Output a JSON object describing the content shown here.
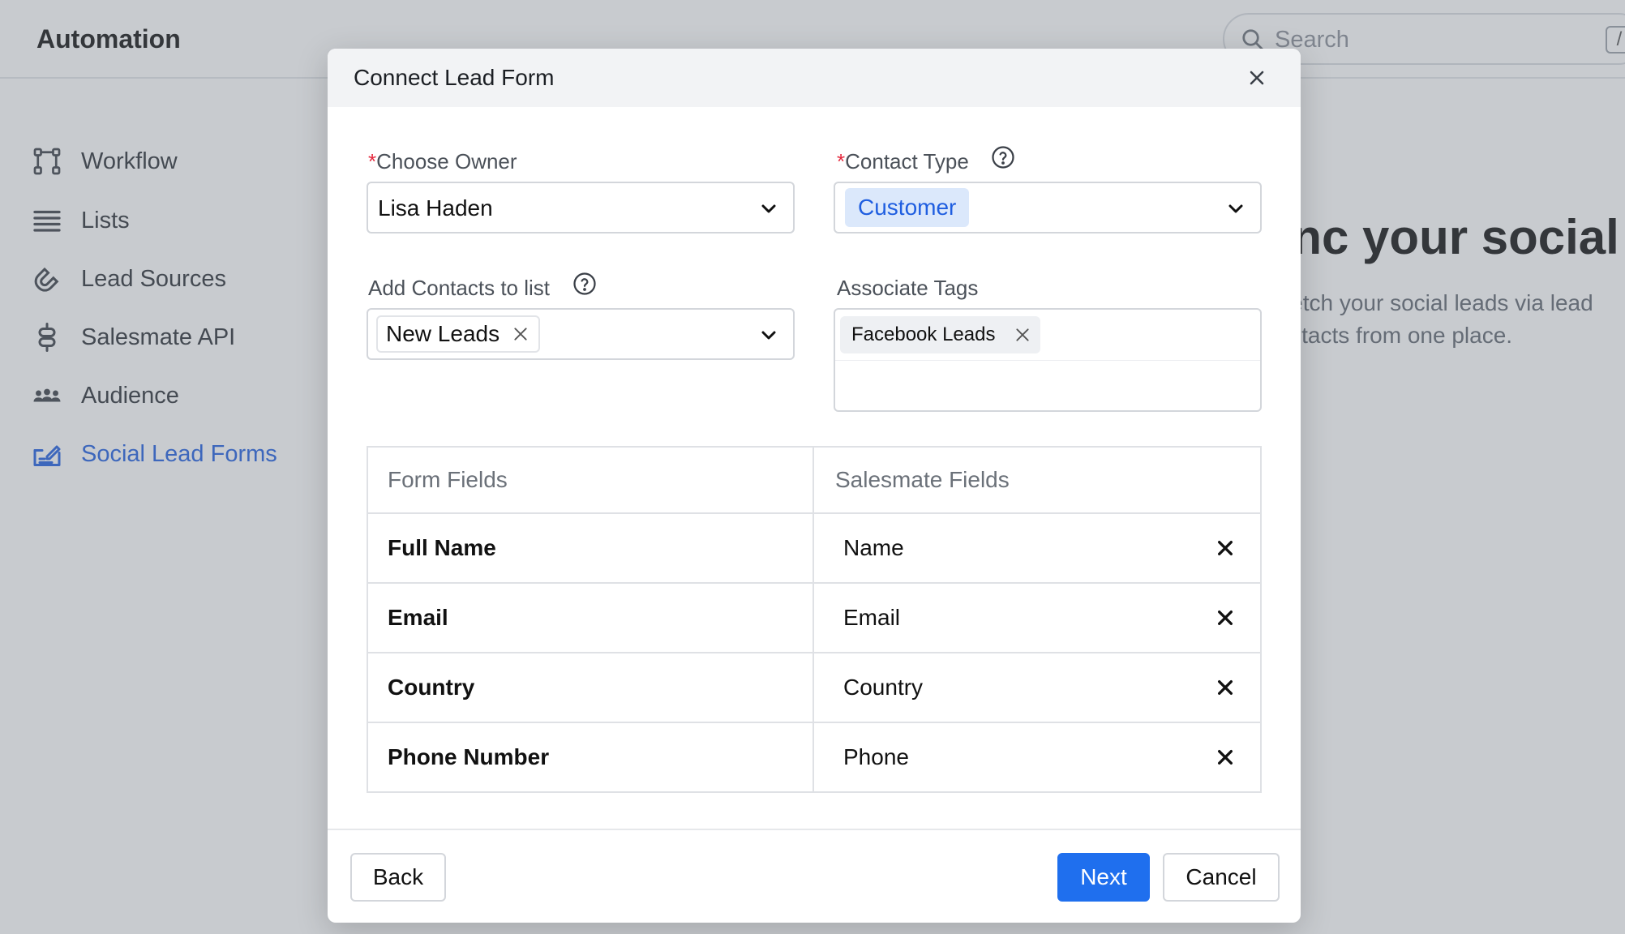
{
  "app": {
    "title": "Automation",
    "search": {
      "placeholder": "Search",
      "shortcut": "/"
    }
  },
  "sidebar": {
    "items": [
      {
        "label": "Workflow",
        "icon": "workflow-icon",
        "active": false
      },
      {
        "label": "Lists",
        "icon": "list-icon",
        "active": false
      },
      {
        "label": "Lead Sources",
        "icon": "magnet-icon",
        "active": false
      },
      {
        "label": "Salesmate API",
        "icon": "api-icon",
        "active": false
      },
      {
        "label": "Audience",
        "icon": "audience-icon",
        "active": false
      },
      {
        "label": "Social Lead Forms",
        "icon": "form-icon",
        "active": true
      }
    ]
  },
  "hero": {
    "title": "ync your social",
    "line1": "o fetch your social leads via lead",
    "line2": "contacts from one place."
  },
  "modal": {
    "title": "Connect Lead Form",
    "owner": {
      "required_mark": "*",
      "label": "Choose Owner",
      "value": "Lisa Haden"
    },
    "contact_type": {
      "required_mark": "*",
      "label": "Contact Type",
      "value": "Customer"
    },
    "contacts_list": {
      "label": "Add Contacts to list",
      "value": "New Leads"
    },
    "tags": {
      "label": "Associate Tags",
      "values": [
        "Facebook Leads"
      ]
    },
    "mapping": {
      "headers": {
        "form": "Form Fields",
        "salesmate": "Salesmate Fields"
      },
      "rows": [
        {
          "form": "Full Name",
          "salesmate": "Name"
        },
        {
          "form": "Email",
          "salesmate": "Email"
        },
        {
          "form": "Country",
          "salesmate": "Country"
        },
        {
          "form": "Phone Number",
          "salesmate": "Phone"
        }
      ]
    },
    "buttons": {
      "back": "Back",
      "next": "Next",
      "cancel": "Cancel"
    }
  },
  "colors": {
    "accent": "#1f6fee",
    "active_nav": "#1f5ee0",
    "required": "#e5283d",
    "chip_blue_bg": "#dbe8fb"
  }
}
